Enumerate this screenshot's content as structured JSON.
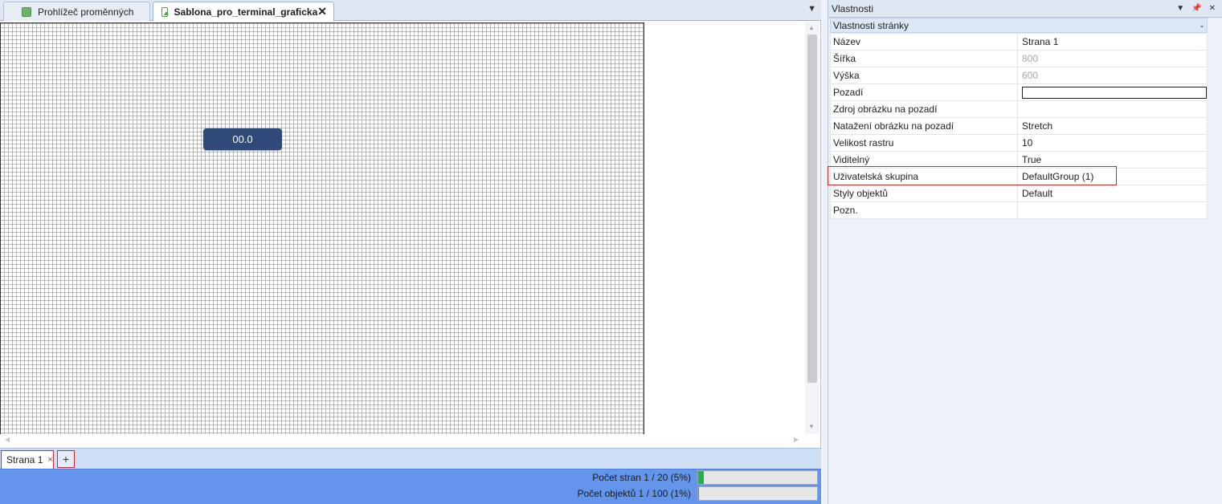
{
  "tabs": [
    {
      "label": "Prohlížeč proměnných",
      "active": false
    },
    {
      "label": "Sablona_pro_terminal_graficka",
      "active": true
    }
  ],
  "canvas": {
    "display_value": "00.0"
  },
  "page_tabs": {
    "page_label": "Strana 1",
    "close_glyph": "×",
    "add_glyph": "+"
  },
  "status": {
    "pages": {
      "label": "Počet stran 1 / 20 (5%)",
      "progress": 0.05
    },
    "objects": {
      "label": "Počet objektů 1 / 100 (1%)",
      "progress": 0.01
    }
  },
  "properties": {
    "title": "Vlastnosti",
    "section": "Vlastnosti stránky",
    "collapse_glyph": "-",
    "rows": [
      {
        "key": "Název",
        "value": "Strana 1"
      },
      {
        "key": "Šířka",
        "value": "800"
      },
      {
        "key": "Výška",
        "value": "600"
      },
      {
        "key": "Pozadí",
        "value": ""
      },
      {
        "key": "Zdroj obrázku na pozadí",
        "value": ""
      },
      {
        "key": "Natažení obrázku na pozadí",
        "value": "Stretch"
      },
      {
        "key": "Velikost rastru",
        "value": "10"
      },
      {
        "key": "Viditelný",
        "value": "True"
      },
      {
        "key": "Uživatelská skupina",
        "value": "DefaultGroup (1)"
      },
      {
        "key": "Styly objektů",
        "value": "Default"
      },
      {
        "key": "Pozn.",
        "value": ""
      }
    ]
  },
  "colors": {
    "accent_blue": "#6495ed",
    "display_bg": "#2f4a78",
    "highlight_red": "#d9242a",
    "progress_green": "#22b14c"
  }
}
